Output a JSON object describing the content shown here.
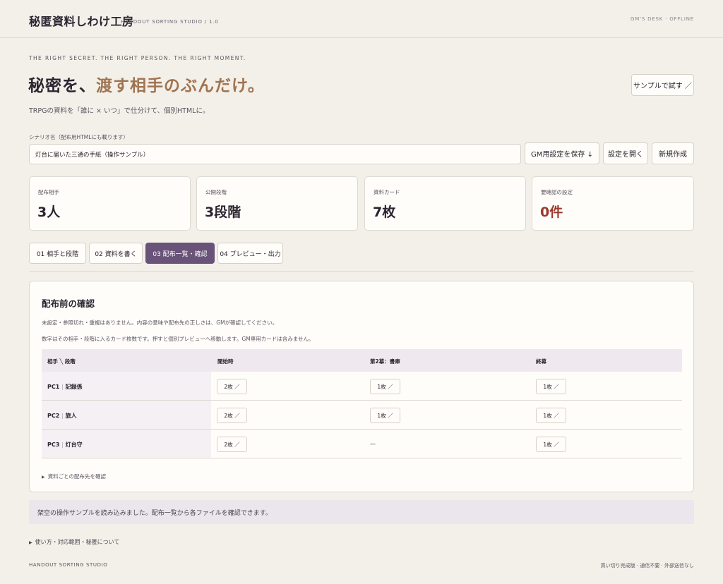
{
  "header": {
    "app_title": "秘匿資料しわけ工房",
    "app_subtitle": "HANDOUT SORTING STUDIO / 1.0",
    "status": "GM'S DESK · OFFLINE"
  },
  "hero": {
    "tagline": "THE RIGHT SECRET. THE RIGHT PERSON. THE RIGHT MOMENT.",
    "headline_plain": "秘密を、",
    "headline_accent": "渡す相手のぶんだけ。",
    "subline": "TRPGの資料を「誰に × いつ」で仕分けて、個別HTMLに。",
    "sample_button": "サンプルで試す ／"
  },
  "scenario": {
    "label": "シナリオ名（配布用HTMLにも載ります）",
    "value": "灯台に届いた三通の手紙（操作サンプル）",
    "save_button": "GM用設定を保存 ↓",
    "open_button": "設定を開く",
    "new_button": "新規作成"
  },
  "stats": [
    {
      "label": "配布相手",
      "value": "3人"
    },
    {
      "label": "公開段階",
      "value": "3段階"
    },
    {
      "label": "資料カード",
      "value": "7枚"
    },
    {
      "label": "要確認の設定",
      "value": "0件"
    }
  ],
  "tabs": [
    {
      "label": "01 相手と段階",
      "active": false
    },
    {
      "label": "02 資料を書く",
      "active": false
    },
    {
      "label": "03 配布一覧・確認",
      "active": true
    },
    {
      "label": "04 プレビュー・出力",
      "active": false
    }
  ],
  "panel": {
    "title": "配布前の確認",
    "note1": "未設定・参照切れ・重複はありません。内容の意味や配布先の正しさは、GMが確認してください。",
    "note2": "数字はその相手・段階に入るカード枚数です。押すと個別プレビューへ移動します。GM専用カードは含みません。",
    "columns": [
      "相手 ╲ 段階",
      "開始時",
      "第2幕：書庫",
      "終幕"
    ],
    "rows": [
      {
        "id": "PC1",
        "name": "記録係",
        "cells": [
          "2枚 ／",
          "1枚 ／",
          "1枚 ／"
        ]
      },
      {
        "id": "PC2",
        "name": "旅人",
        "cells": [
          "2枚 ／",
          "1枚 ／",
          "1枚 ／"
        ]
      },
      {
        "id": "PC3",
        "name": "灯台守",
        "cells": [
          "2枚 ／",
          "—",
          "1枚 ／"
        ]
      }
    ],
    "details_label": "資料ごとの配布先を確認"
  },
  "notice": "架空の操作サンプルを読み込みました。配布一覧から各ファイルを確認できます。",
  "usage_label": "使い方・対応範囲・秘匿について",
  "footer": {
    "left": "HANDOUT SORTING STUDIO",
    "right": "買い切り完成版 · 通信不要 · 外部送信なし"
  },
  "colors": {
    "accent": "#a07450",
    "active_tab": "#6a5378",
    "warning": "#9a3a2e",
    "background": "#f3f0ea"
  }
}
